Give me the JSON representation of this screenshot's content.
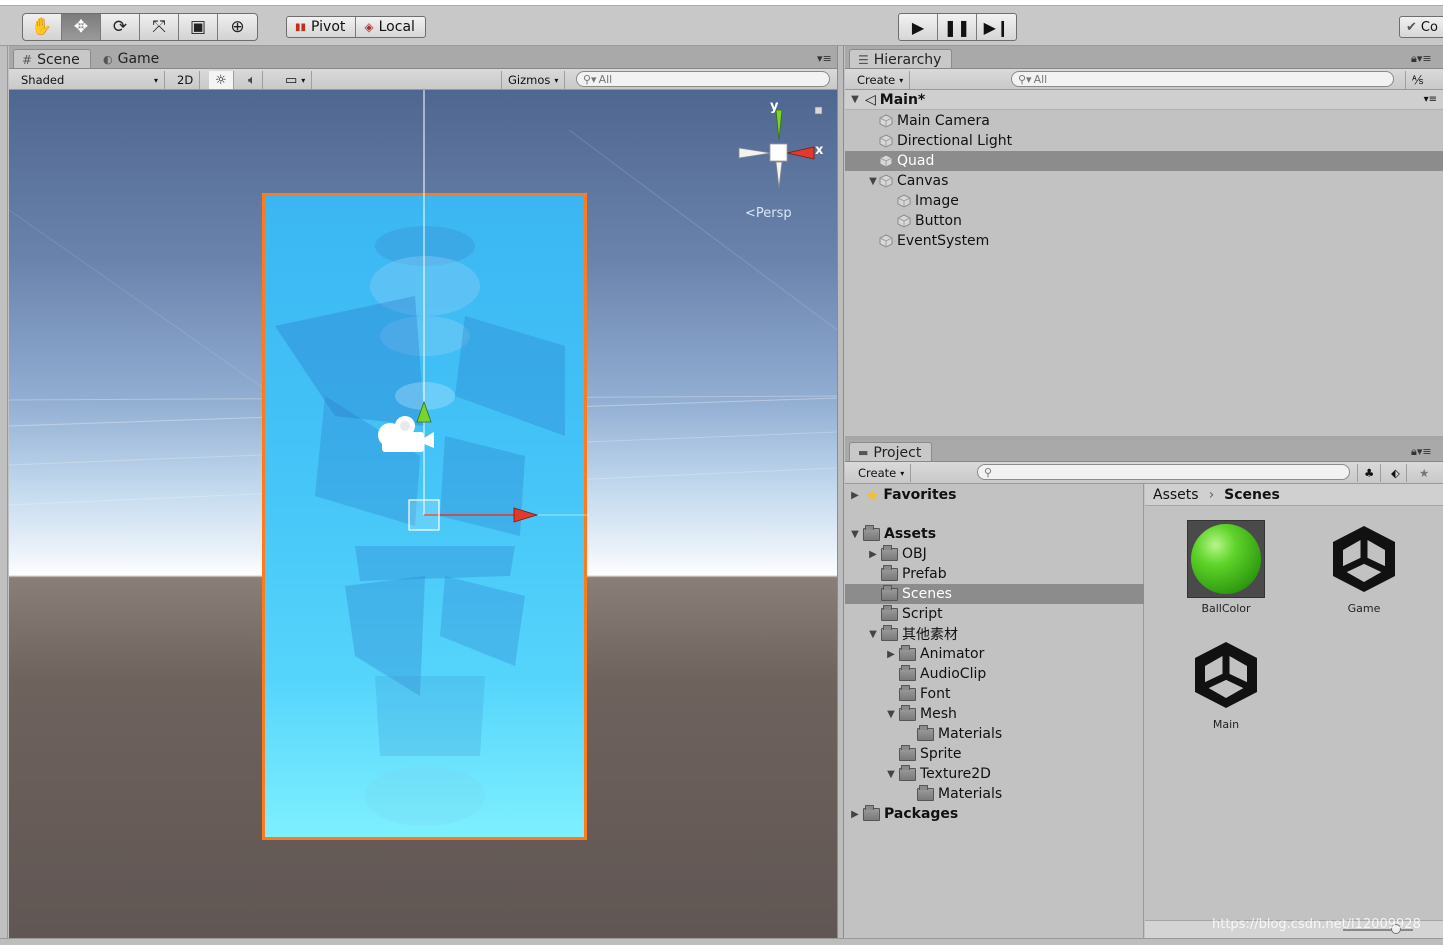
{
  "toolbar": {
    "transform_tools": [
      "hand-tool",
      "move-tool",
      "rotate-tool",
      "scale-tool",
      "rect-tool",
      "transform-tool"
    ],
    "pivot_label": "Pivot",
    "local_label": "Local",
    "play_buttons": [
      "play",
      "pause",
      "step"
    ],
    "collab_label": "Co"
  },
  "scene_panel": {
    "tabs": [
      {
        "label": "Scene",
        "icon": "grid-icon"
      },
      {
        "label": "Game",
        "icon": "pacman-icon"
      }
    ],
    "shading_mode": "Shaded",
    "mode_2d": "2D",
    "gizmos_label": "Gizmos",
    "search_placeholder": "All",
    "projection_label": "Persp",
    "axis_x": "x",
    "axis_y": "y"
  },
  "hierarchy_panel": {
    "tab_label": "Hierarchy",
    "create_label": "Create",
    "search_placeholder": "All",
    "scene_name": "Main*",
    "items": [
      {
        "label": "Main Camera",
        "depth": 1,
        "expander": "",
        "selected": false
      },
      {
        "label": "Directional Light",
        "depth": 1,
        "expander": "",
        "selected": false
      },
      {
        "label": "Quad",
        "depth": 1,
        "expander": "",
        "selected": true
      },
      {
        "label": "Canvas",
        "depth": 1,
        "expander": "▼",
        "selected": false
      },
      {
        "label": "Image",
        "depth": 2,
        "expander": "",
        "selected": false
      },
      {
        "label": "Button",
        "depth": 2,
        "expander": "",
        "selected": false
      },
      {
        "label": "EventSystem",
        "depth": 1,
        "expander": "",
        "selected": false
      }
    ]
  },
  "project_panel": {
    "tab_label": "Project",
    "create_label": "Create",
    "favorites_label": "Favorites",
    "tree": [
      {
        "label": "Assets",
        "depth": 0,
        "expander": "▼",
        "bold": true,
        "selected": false
      },
      {
        "label": "OBJ",
        "depth": 1,
        "expander": "▶",
        "bold": false,
        "selected": false
      },
      {
        "label": "Prefab",
        "depth": 1,
        "expander": "",
        "bold": false,
        "selected": false
      },
      {
        "label": "Scenes",
        "depth": 1,
        "expander": "",
        "bold": false,
        "selected": true
      },
      {
        "label": "Script",
        "depth": 1,
        "expander": "",
        "bold": false,
        "selected": false
      },
      {
        "label": "其他素材",
        "depth": 1,
        "expander": "▼",
        "bold": false,
        "selected": false
      },
      {
        "label": "Animator",
        "depth": 2,
        "expander": "▶",
        "bold": false,
        "selected": false
      },
      {
        "label": "AudioClip",
        "depth": 2,
        "expander": "",
        "bold": false,
        "selected": false
      },
      {
        "label": "Font",
        "depth": 2,
        "expander": "",
        "bold": false,
        "selected": false
      },
      {
        "label": "Mesh",
        "depth": 2,
        "expander": "▼",
        "bold": false,
        "selected": false
      },
      {
        "label": "Materials",
        "depth": 3,
        "expander": "",
        "bold": false,
        "selected": false
      },
      {
        "label": "Sprite",
        "depth": 2,
        "expander": "",
        "bold": false,
        "selected": false
      },
      {
        "label": "Texture2D",
        "depth": 2,
        "expander": "▼",
        "bold": false,
        "selected": false
      },
      {
        "label": "Materials",
        "depth": 3,
        "expander": "",
        "bold": false,
        "selected": false
      },
      {
        "label": "Packages",
        "depth": 0,
        "expander": "▶",
        "bold": true,
        "selected": false
      }
    ],
    "breadcrumb": [
      "Assets",
      "Scenes"
    ],
    "assets": [
      {
        "label": "BallColor",
        "kind": "material-sphere"
      },
      {
        "label": "Game",
        "kind": "unity-scene"
      },
      {
        "label": "Main",
        "kind": "unity-scene"
      }
    ]
  },
  "watermark": "https://blog.csdn.net/l12009928",
  "colors": {
    "selection": "#8c8c8c",
    "quad_outline": "#ff7a1c",
    "gizmo_x": "#e03a2a",
    "gizmo_y": "#7ad42a"
  }
}
